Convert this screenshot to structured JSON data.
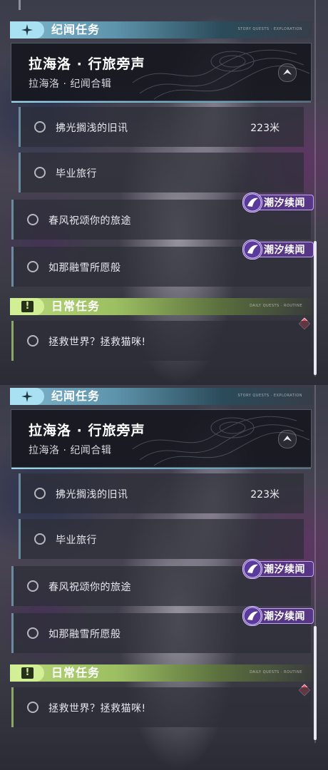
{
  "story_section": {
    "title": "纪闻任务",
    "caption": "STORY QUESTS · EXPLORATION"
  },
  "quest_card": {
    "title": "拉海洛 · 行旅旁声",
    "subtitle": "拉海洛 · 纪闻合辑"
  },
  "tasks": [
    {
      "label": "拂光搁浅的旧讯",
      "distance": "223米"
    },
    {
      "label": "毕业旅行"
    },
    {
      "label": "春风祝颂你的旅途",
      "badge": "潮汐续闻"
    },
    {
      "label": "如那融雪所愿般",
      "badge": "潮汐续闻"
    }
  ],
  "daily_section": {
    "title": "日常任务",
    "caption": "DAILY QUESTS · ROUTINE"
  },
  "daily_tasks": [
    {
      "label": "拯救世界？拯救猫咪!"
    }
  ],
  "colors": {
    "story_accent": "#a9e0f2",
    "daily_accent": "#d3ef95",
    "badge_purple": "#5a3a9a",
    "alert_red": "#e44c60"
  },
  "icons": {
    "story": "sparkle-star-icon",
    "daily": "exclamation-box-icon",
    "collapse": "chevron-up-icon",
    "badge": "tide-emblem-icon"
  }
}
